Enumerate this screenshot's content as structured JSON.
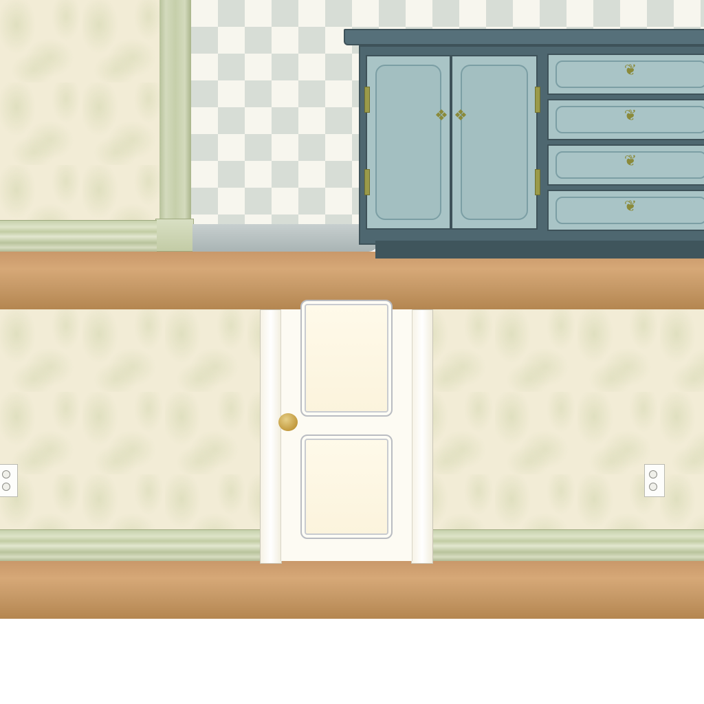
{
  "scene": {
    "name": "room-side-view",
    "upper_room": {
      "furniture": "dresser",
      "dresser": {
        "doors": 2,
        "drawers": 4
      }
    },
    "lower_room": {
      "door": "white-paneled-door",
      "outlets": 2
    }
  },
  "icons": {
    "drawer_pull": "drawer-pull-icon",
    "door_knob": "door-knob-icon",
    "outlet": "wall-outlet-icon"
  },
  "colors": {
    "wallpaper": "#f2ecd6",
    "floor": "#c9986a",
    "dresser": "#a9c4c6",
    "dresser_frame": "#4e6770",
    "door": "#fdfbf3",
    "baseboard": "#c7d1ad"
  }
}
